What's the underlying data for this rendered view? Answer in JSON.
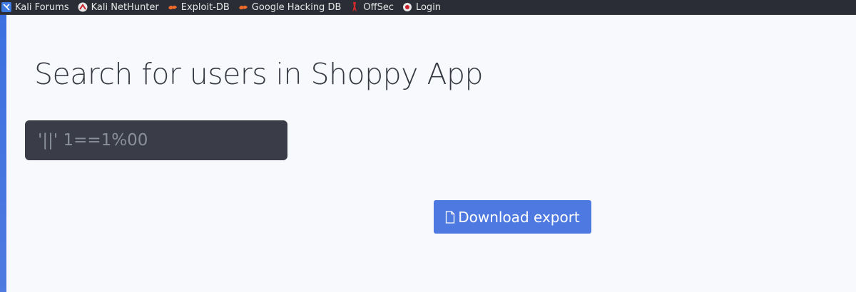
{
  "bookmarks": [
    {
      "label": "Kali Forums",
      "icon": "kali-dragon-icon"
    },
    {
      "label": "Kali NetHunter",
      "icon": "nethunter-icon"
    },
    {
      "label": "Exploit-DB",
      "icon": "exploit-db-icon"
    },
    {
      "label": "Google Hacking DB",
      "icon": "exploit-db-icon"
    },
    {
      "label": "OffSec",
      "icon": "offsec-icon"
    },
    {
      "label": "Login",
      "icon": "login-icon"
    }
  ],
  "main": {
    "title": "Search for users in Shoppy App",
    "search": {
      "value": "",
      "placeholder": "'||' 1==1%00"
    },
    "export_button": {
      "label": "Download export",
      "icon": "file-icon"
    }
  },
  "colors": {
    "page_background": "#f8f9fd",
    "bookmarks_bar": "#2a2d35",
    "accent": "#4e79e0",
    "input_background": "#3a3d47",
    "title_text": "#353a42"
  }
}
